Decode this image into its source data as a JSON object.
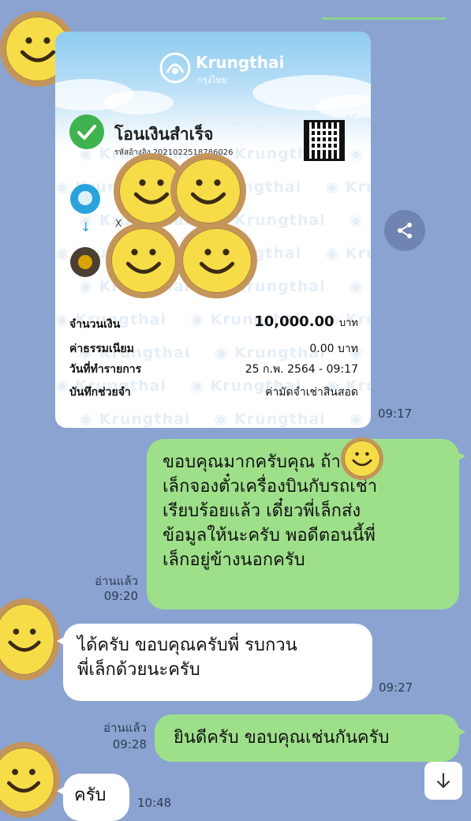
{
  "receipt": {
    "bank_name": "Krungthai",
    "bank_name_sub": "กรุงไทย",
    "title": "โอนเงินสำเร็จ",
    "ref": "รหัสอ้างอิง 2021022518786026",
    "recipient_masked": "X",
    "watermark": "Krungthai",
    "rows": [
      {
        "label": "จำนวนเงิน",
        "value": "10,000.00",
        "unit": "บาท"
      },
      {
        "label": "ค่าธรรมเนียม",
        "value": "0.00 บาท"
      },
      {
        "label": "วันที่ทำรายการ",
        "value": "25 ก.พ. 2564 - 09:17"
      },
      {
        "label": "บันทึกช่วยจำ",
        "value": "ค่ามัดจำเช่าสินสอด"
      }
    ],
    "time": "09:17"
  },
  "messages": [
    {
      "lines": [
        "ขอบคุณมากครับคุณ      ถ้าพี่",
        "เล็กจองตั๋วเครื่องบินกับรถเช่า",
        "เรียบร้อยแล้ว เดี๋ยวพี่เล็กส่ง",
        "ข้อมูลให้นะครับ พอดีตอนนี้พี่",
        "เล็กอยู่ข้างนอกครับ"
      ],
      "read": "อ่านแล้ว",
      "time": "09:20"
    },
    {
      "lines": [
        "ได้ครับ ขอบคุณครับพี่ รบกวน",
        "พี่เล็กด้วยนะครับ"
      ],
      "time": "09:27"
    },
    {
      "lines": [
        "ยินดีครับ ขอบคุณเช่นกันครับ"
      ],
      "read": "อ่านแล้ว",
      "time": "09:28"
    },
    {
      "lines": [
        "ครับ"
      ],
      "time": "10:48"
    }
  ],
  "icons": {
    "share": "share-icon",
    "scroll_down": "arrow-down-icon",
    "check": "check-icon",
    "avatar": "smiley-avatar"
  },
  "colors": {
    "background": "#8aa3d1",
    "outgoing_bubble": "#9ee08a",
    "incoming_bubble": "#ffffff",
    "success_green": "#3fb34f"
  }
}
